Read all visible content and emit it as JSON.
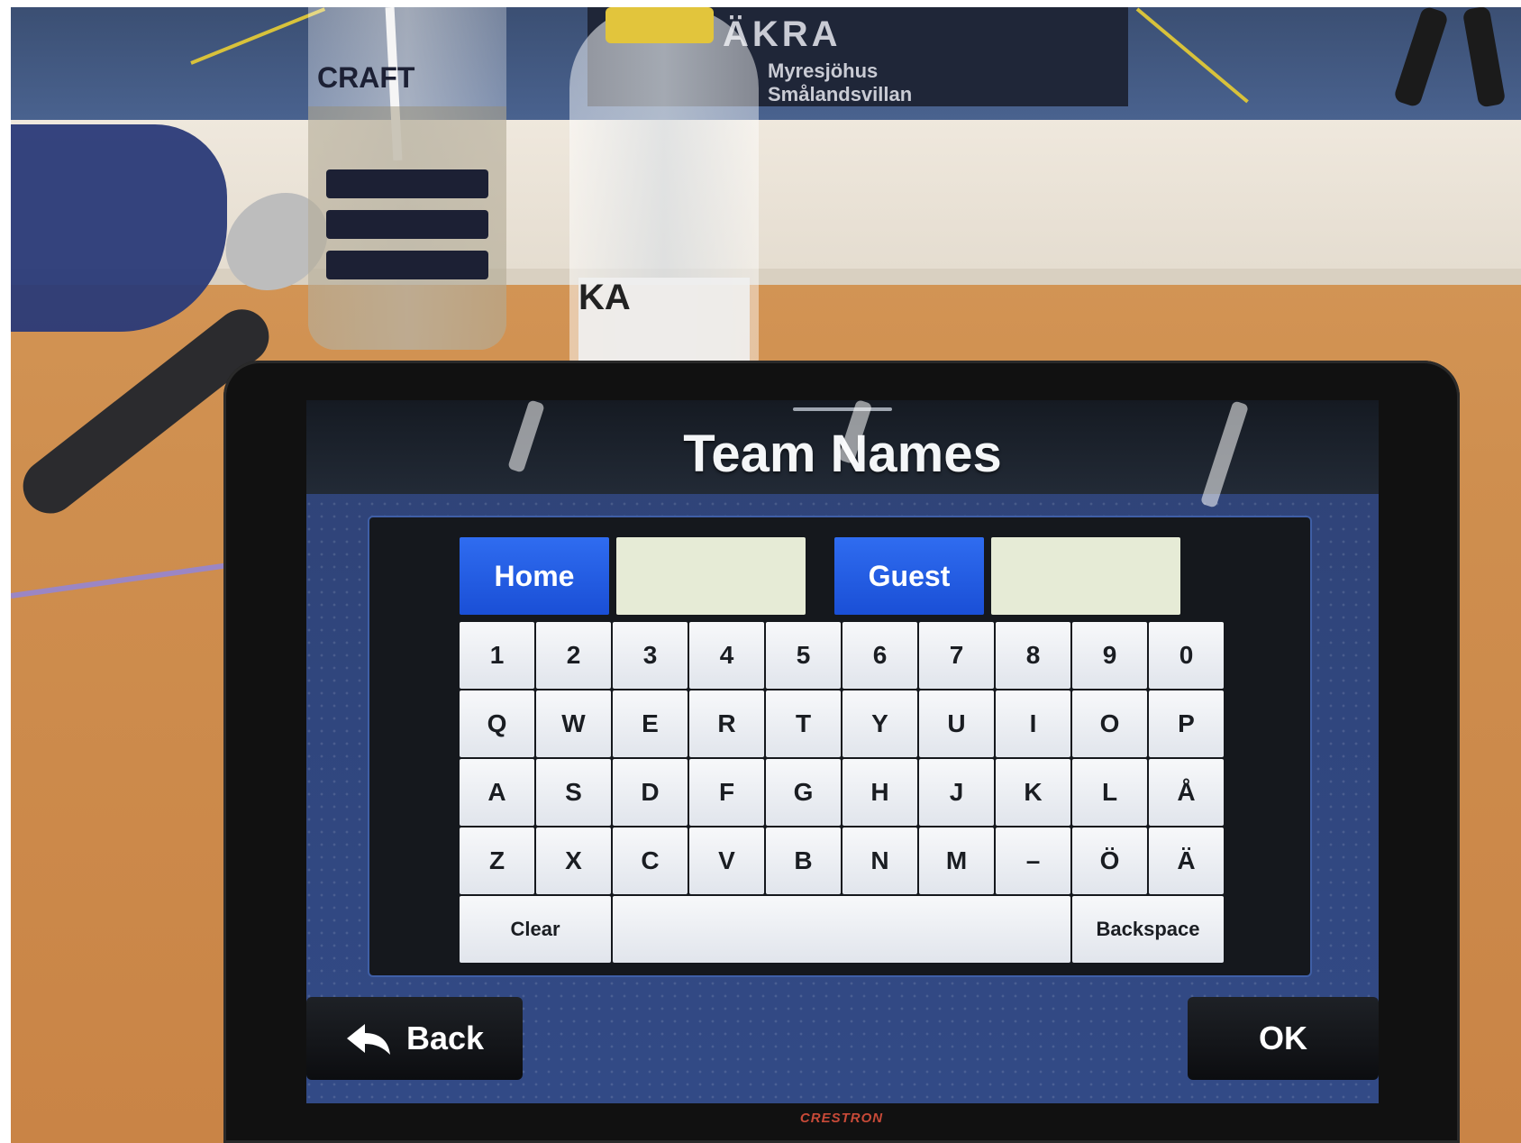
{
  "screen": {
    "title": "Team Names",
    "home_button": "Home",
    "guest_button": "Guest",
    "home_value": "",
    "guest_value": "",
    "keyboard_rows": [
      [
        "1",
        "2",
        "3",
        "4",
        "5",
        "6",
        "7",
        "8",
        "9",
        "0"
      ],
      [
        "Q",
        "W",
        "E",
        "R",
        "T",
        "Y",
        "U",
        "I",
        "O",
        "P"
      ],
      [
        "A",
        "S",
        "D",
        "F",
        "G",
        "H",
        "J",
        "K",
        "L",
        "Å"
      ],
      [
        "Z",
        "X",
        "C",
        "V",
        "B",
        "N",
        "M",
        "–",
        "Ö",
        "Ä"
      ]
    ],
    "clear_key": "Clear",
    "space_key": "",
    "backspace_key": "Backspace",
    "back_button": "Back",
    "ok_button": "OK"
  },
  "device": {
    "brand": "CRESTRON"
  },
  "surroundings": {
    "banner_text": "ÄKRA",
    "banner_subtext": [
      "Myresjöhus",
      "Smålandsvillan"
    ],
    "glass_brand": "CRAFT",
    "bottle_label": "KA"
  },
  "colors": {
    "accent_blue": "#1a4fd6",
    "screen_bg": "#324a86",
    "key_bg": "#eef0f4",
    "field_bg": "#e6ebd6"
  },
  "icons": {
    "back": "back-arrow-icon"
  }
}
